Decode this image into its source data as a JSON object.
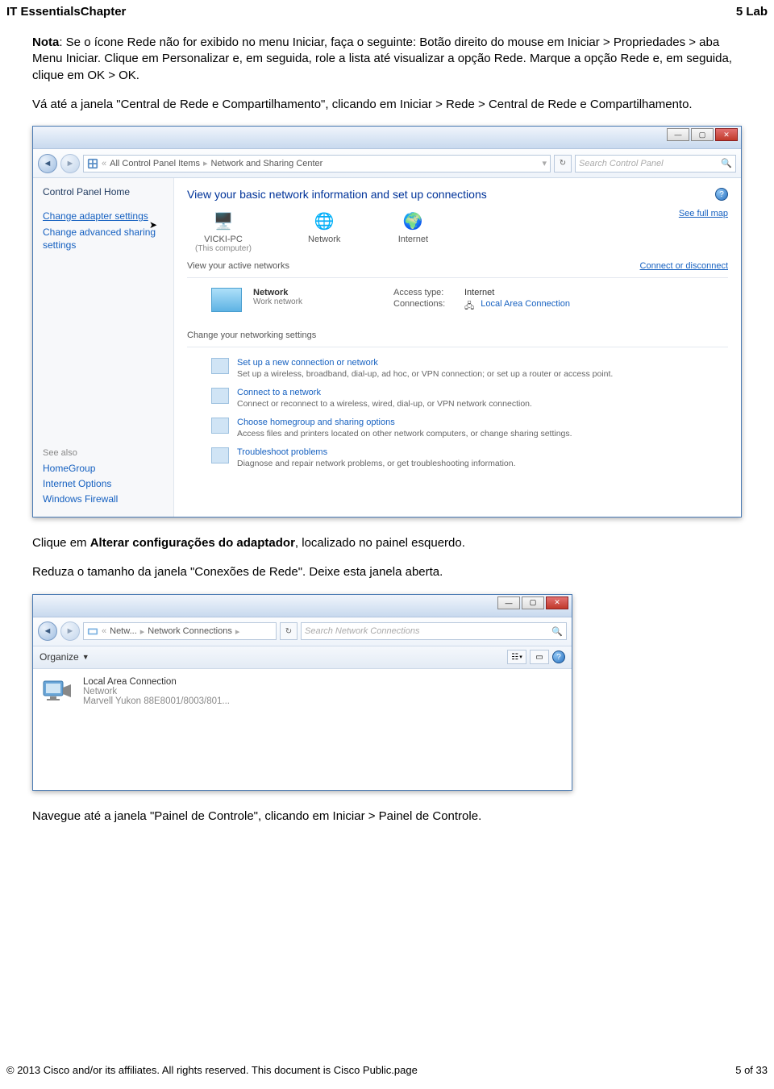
{
  "header": {
    "left": "IT EssentialsChapter",
    "right": "5 Lab"
  },
  "paras": {
    "p1_label": "Nota",
    "p1_rest": ": Se o ícone Rede não for exibido no menu Iniciar, faça o seguinte: Botão direito do mouse em Iniciar > Propriedades > aba Menu Iniciar. Clique em Personalizar e, em seguida, role a lista até visualizar a opção Rede. Marque a opção Rede e, em seguida, clique em OK > OK.",
    "p2": "Vá até a janela \"Central de Rede e Compartilhamento\", clicando em Iniciar > Rede > Central de Rede e Compartilhamento.",
    "p3_pre": "Clique em ",
    "p3_bold": "Alterar configurações do adaptador",
    "p3_post": ", localizado no painel esquerdo.",
    "p4": "Reduza o tamanho da janela \"Conexões de Rede\". Deixe esta janela aberta.",
    "p5": "Navegue até a janela \"Painel de Controle\", clicando em Iniciar > Painel de Controle."
  },
  "win1": {
    "addr": {
      "seg1": "All Control Panel Items",
      "seg2": "Network and Sharing Center"
    },
    "search_ph": "Search Control Panel",
    "sidebar": {
      "home": "Control Panel Home",
      "link1": "Change adapter settings",
      "link2": "Change advanced sharing settings",
      "also": "See also",
      "s1": "HomeGroup",
      "s2": "Internet Options",
      "s3": "Windows Firewall"
    },
    "main": {
      "title": "View your basic network information and set up connections",
      "fullmap": "See full map",
      "node1": "VICKI-PC",
      "node1_sub": "(This computer)",
      "node2": "Network",
      "node3": "Internet",
      "active_label": "View your active networks",
      "connect_link": "Connect or disconnect",
      "net_name": "Network",
      "net_type": "Work network",
      "access_l": "Access type:",
      "access_v": "Internet",
      "conn_l": "Connections:",
      "conn_v": "Local Area Connection",
      "chg_head": "Change your networking settings",
      "t1": "Set up a new connection or network",
      "t1d": "Set up a wireless, broadband, dial-up, ad hoc, or VPN connection; or set up a router or access point.",
      "t2": "Connect to a network",
      "t2d": "Connect or reconnect to a wireless, wired, dial-up, or VPN network connection.",
      "t3": "Choose homegroup and sharing options",
      "t3d": "Access files and printers located on other network computers, or change sharing settings.",
      "t4": "Troubleshoot problems",
      "t4d": "Diagnose and repair network problems, or get troubleshooting information."
    }
  },
  "win2": {
    "addr": {
      "seg1": "Netw...",
      "seg2": "Network Connections"
    },
    "search_ph": "Search Network Connections",
    "organize": "Organize",
    "conn_name": "Local Area Connection",
    "conn_status": "Network",
    "conn_dev": "Marvell Yukon 88E8001/8003/801..."
  },
  "footer": {
    "left": "© 2013 Cisco and/or its affiliates. All rights reserved. This document is Cisco Public.page",
    "right": "5 of 33"
  }
}
